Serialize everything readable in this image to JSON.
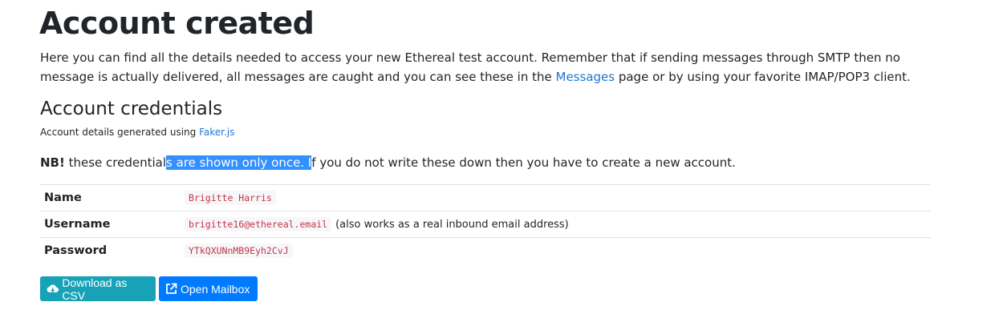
{
  "page": {
    "title": "Account created",
    "intro_before_link": "Here you can find all the details needed to access your new Ethereal test account. Remember that if sending messages through SMTP then no message is actually delivered, all messages are caught and you can see these in the ",
    "intro_link": "Messages",
    "intro_after_link": " page or by using your favorite IMAP/POP3 client."
  },
  "credentials": {
    "heading": "Account credentials",
    "generated_prefix": "Account details generated using ",
    "generated_link": "Faker.js",
    "nb_label": "NB!",
    "nb_text_1": " these credential",
    "nb_text_selected": "s are shown only once. I",
    "nb_text_2": "f you do not write these down then you have to create a new account."
  },
  "table": {
    "rows": [
      {
        "label": "Name",
        "value": "Brigitte Harris",
        "note": ""
      },
      {
        "label": "Username",
        "value": "brigitte16@ethereal.email",
        "note": "(also works as a real inbound email address)"
      },
      {
        "label": "Password",
        "value": "YTkQXUNnMB9Eyh2CvJ",
        "note": ""
      }
    ]
  },
  "buttons": {
    "download_csv": "Download as CSV",
    "open_mailbox": "Open Mailbox",
    "download_icon": "cloud-download-icon",
    "mailbox_icon": "external-link-icon"
  },
  "colors": {
    "link": "#1f74d4",
    "info": "#17a2b8",
    "primary": "#007bff",
    "selection": "#3390ff"
  }
}
